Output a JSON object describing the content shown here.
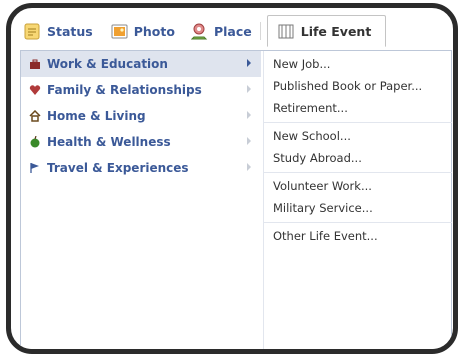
{
  "tabs": [
    {
      "label": "Status",
      "icon": "status-icon"
    },
    {
      "label": "Photo",
      "icon": "photo-icon"
    },
    {
      "label": "Place",
      "icon": "place-icon"
    },
    {
      "label": "Life Event",
      "icon": "life-event-icon"
    }
  ],
  "menu": {
    "items": [
      {
        "label": "Work & Education",
        "icon": "briefcase-icon",
        "color": "#8b2a2a"
      },
      {
        "label": "Family & Relationships",
        "icon": "heart-icon",
        "color": "#b03a3a"
      },
      {
        "label": "Home & Living",
        "icon": "house-icon",
        "color": "#6b4a1e"
      },
      {
        "label": "Health & Wellness",
        "icon": "apple-icon",
        "color": "#3a8a2a"
      },
      {
        "label": "Travel & Experiences",
        "icon": "flag-icon",
        "color": "#3b5998"
      }
    ]
  },
  "submenu": {
    "group1": [
      "New Job...",
      "Published Book or Paper...",
      "Retirement..."
    ],
    "group2": [
      "New School...",
      "Study Abroad..."
    ],
    "group3": [
      "Volunteer Work...",
      "Military Service..."
    ],
    "group4": [
      "Other Life Event..."
    ]
  },
  "colors": {
    "link": "#3b5998",
    "selected_bg": "#dfe4ee",
    "border": "#bdc7d8"
  }
}
